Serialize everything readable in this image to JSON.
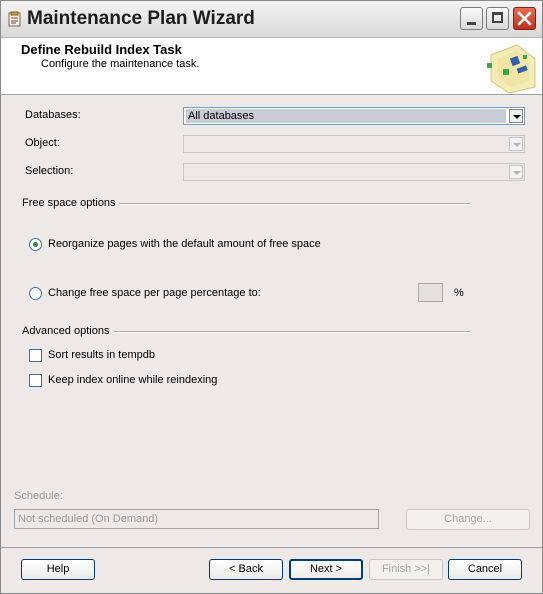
{
  "window": {
    "title": "Maintenance Plan Wizard"
  },
  "header": {
    "title": "Define Rebuild Index Task",
    "subtitle": "Configure the maintenance task."
  },
  "form": {
    "databases_label": "Databases:",
    "databases_value": "All databases",
    "object_label": "Object:",
    "object_value": "",
    "selection_label": "Selection:",
    "selection_value": ""
  },
  "free_space": {
    "group_label": "Free space options",
    "option_reorganize": "Reorganize pages with the default amount of free space",
    "option_change": "Change free space per page percentage to:",
    "percent_value": "",
    "percent_symbol": "%",
    "selected": "reorganize"
  },
  "advanced": {
    "group_label": "Advanced options",
    "sort_label": "Sort results in tempdb",
    "sort_checked": false,
    "online_label": "Keep index online while reindexing",
    "online_checked": false
  },
  "schedule": {
    "label": "Schedule:",
    "value": "Not scheduled (On Demand)",
    "change_button": "Change..."
  },
  "footer": {
    "help": "Help",
    "back": "< Back",
    "next": "Next >",
    "finish": "Finish >>|",
    "cancel": "Cancel"
  }
}
